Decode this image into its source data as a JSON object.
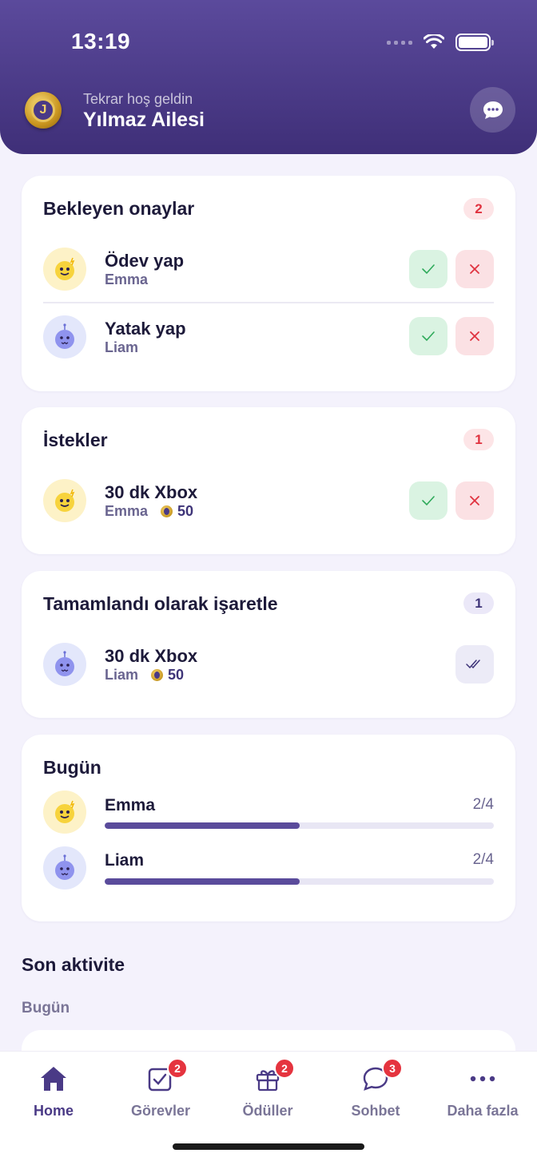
{
  "status": {
    "time": "13:19"
  },
  "header": {
    "subtitle": "Tekrar hoş geldin",
    "title": "Yılmaz Ailesi",
    "logo_letter": "J"
  },
  "pending": {
    "title": "Bekleyen onaylar",
    "count": "2",
    "items": [
      {
        "title": "Ödev yap",
        "child": "Emma"
      },
      {
        "title": "Yatak yap",
        "child": "Liam"
      }
    ]
  },
  "requests": {
    "title": "İstekler",
    "count": "1",
    "items": [
      {
        "title": "30 dk Xbox",
        "child": "Emma",
        "coins": "50"
      }
    ]
  },
  "mark_done": {
    "title": "Tamamlandı olarak işaretle",
    "count": "1",
    "items": [
      {
        "title": "30 dk Xbox",
        "child": "Liam",
        "coins": "50"
      }
    ]
  },
  "today": {
    "title": "Bugün",
    "kids": [
      {
        "name": "Emma",
        "count": "2/4",
        "progress": 0.5
      },
      {
        "name": "Liam",
        "count": "2/4",
        "progress": 0.5
      }
    ]
  },
  "activity": {
    "title": "Son aktivite",
    "subtitle": "Bugün"
  },
  "tabs": [
    {
      "label": "Home",
      "icon": "house-icon",
      "badge": ""
    },
    {
      "label": "Görevler",
      "icon": "checklist-icon",
      "badge": "2"
    },
    {
      "label": "Ödüller",
      "icon": "gift-icon",
      "badge": "2"
    },
    {
      "label": "Sohbet",
      "icon": "chat-bubble-icon",
      "badge": "3"
    },
    {
      "label": "Daha fazla",
      "icon": "more-dots-icon",
      "badge": ""
    }
  ],
  "colors": {
    "accent": "#5a4b9b",
    "approve": "#2eaa5a",
    "reject": "#e0323f",
    "badge": "#e5343f"
  }
}
